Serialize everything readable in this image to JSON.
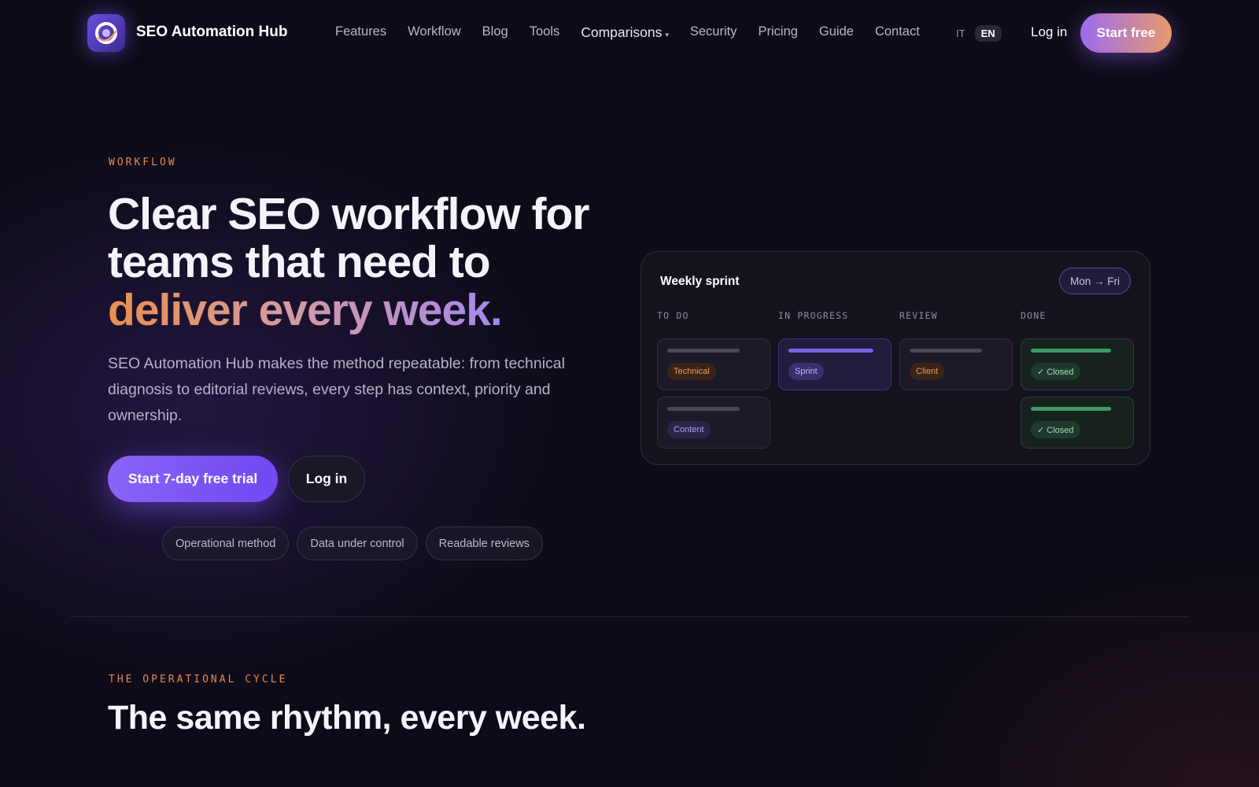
{
  "nav": {
    "brand": "SEO Automation Hub",
    "links": [
      "Features",
      "Workflow",
      "Blog",
      "Tools",
      "Comparisons",
      "Security",
      "Pricing",
      "Guide",
      "Contact"
    ],
    "lang_it": "IT",
    "lang_en": "EN",
    "login": "Log in",
    "cta": "Start free"
  },
  "hero": {
    "eyebrow": "WORKFLOW",
    "title_line1": "Clear SEO workflow for",
    "title_line2": "teams that need to",
    "title_highlight": "deliver every week.",
    "description": "SEO Automation Hub makes the method repeatable: from technical diagnosis to editorial reviews, every step has context, priority and ownership.",
    "primary_cta": "Start 7-day free trial",
    "secondary_cta": "Log in",
    "chips": [
      "Operational method",
      "Data under control",
      "Readable reviews"
    ]
  },
  "sprint": {
    "title": "Weekly sprint",
    "range": "Mon → Fri",
    "columns": [
      "TO DO",
      "IN PROGRESS",
      "REVIEW",
      "DONE"
    ],
    "tasks": {
      "todo": [
        "Technical",
        "Content"
      ],
      "in_progress": [
        "Sprint"
      ],
      "review": [
        "Client"
      ],
      "done": [
        "✓ Closed",
        "✓ Closed"
      ]
    }
  },
  "section2": {
    "eyebrow": "THE OPERATIONAL CYCLE",
    "title": "The same rhythm, every week."
  },
  "colors": {
    "accent_purple": "#7c55f4",
    "accent_orange": "#e5894f",
    "background": "#0d0b17"
  }
}
